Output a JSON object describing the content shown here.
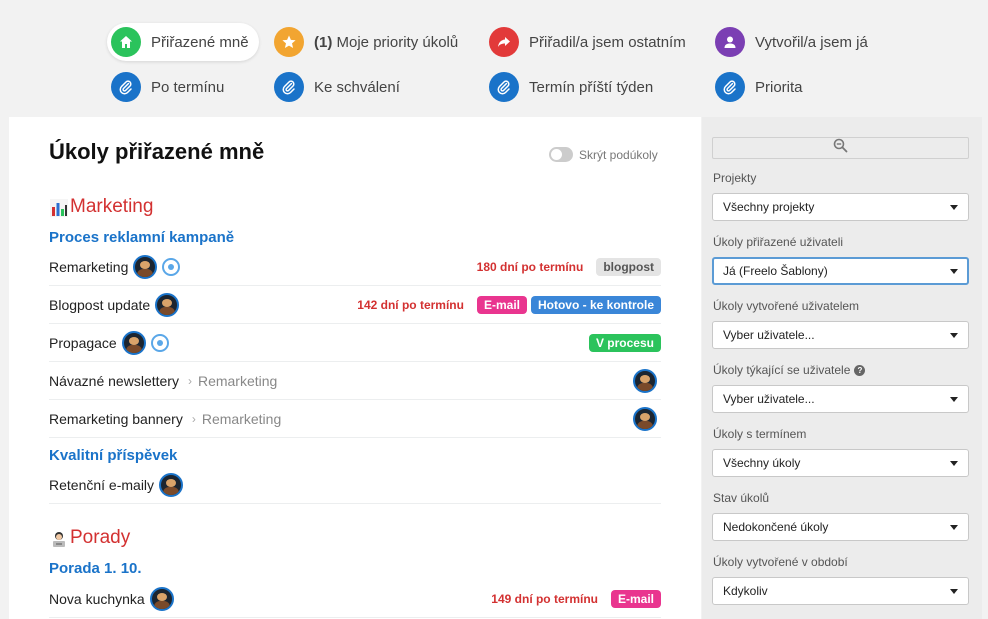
{
  "colors": {
    "accent_blue": "#1a73c9",
    "overdue_red": "#d33131",
    "home_green": "#2bc35c",
    "star_orange": "#f2a531",
    "share_red": "#e23a3a",
    "user_purple": "#7b3fb3",
    "clip_blue": "#1a73c9"
  },
  "filters": [
    {
      "label": "Přiřazené mně",
      "icon": "home-icon"
    },
    {
      "count": "(1)",
      "label": "Moje priority úkolů",
      "icon": "star-icon"
    },
    {
      "label": "Přiřadil/a jsem ostatním",
      "icon": "share-arrow-icon"
    },
    {
      "label": "Vytvořil/a jsem já",
      "icon": "user-icon"
    },
    {
      "label": "Po termínu",
      "icon": "paperclip-icon"
    },
    {
      "label": "Ke schválení",
      "icon": "paperclip-icon"
    },
    {
      "label": "Termín příští týden",
      "icon": "paperclip-icon"
    },
    {
      "label": "Priorita",
      "icon": "paperclip-icon"
    }
  ],
  "main": {
    "title": "Úkoly přiřazené mně",
    "hide_subtasks_label": "Skrýt podúkoly",
    "projects": [
      {
        "name": "Marketing",
        "emoji": "chart-icon"
      },
      {
        "name": "Porady",
        "emoji": "person-at-laptop-icon"
      }
    ],
    "lists": [
      "Proces reklamní kampaně",
      "Kvalitní příspěvek",
      "Porada 1. 10."
    ],
    "tasks": [
      {
        "name": "Remarketing",
        "overdue": "180 dní po termínu",
        "tags": [
          "blogpost"
        ]
      },
      {
        "name": "Blogpost update",
        "overdue": "142 dní po termínu",
        "tags": [
          "E-mail",
          "Hotovo - ke kontrole"
        ]
      },
      {
        "name": "Propagace",
        "tags": [
          "V procesu"
        ]
      },
      {
        "name": "Návazné newslettery",
        "parent": "Remarketing"
      },
      {
        "name": "Remarketing bannery",
        "parent": "Remarketing"
      },
      {
        "name": "Retenční e-maily"
      },
      {
        "name": "Nova kuchynka",
        "overdue": "149 dní po termínu",
        "tags": [
          "E-mail"
        ]
      }
    ]
  },
  "sidebar": {
    "search_icon": "zoom-out-icon",
    "filters": [
      {
        "label": "Projekty",
        "value": "Všechny projekty"
      },
      {
        "label": "Úkoly přiřazené uživateli",
        "value": "Já (Freelo Šablony)"
      },
      {
        "label": "Úkoly vytvořené uživatelem",
        "value": "Vyber uživatele..."
      },
      {
        "label": "Úkoly týkající se uživatele",
        "value": "Vyber uživatele...",
        "help": "?"
      },
      {
        "label": "Úkoly s termínem",
        "value": "Všechny úkoly"
      },
      {
        "label": "Stav úkolů",
        "value": "Nedokončené úkoly"
      },
      {
        "label": "Úkoly vytvořené v období",
        "value": "Kdykoliv"
      }
    ]
  }
}
